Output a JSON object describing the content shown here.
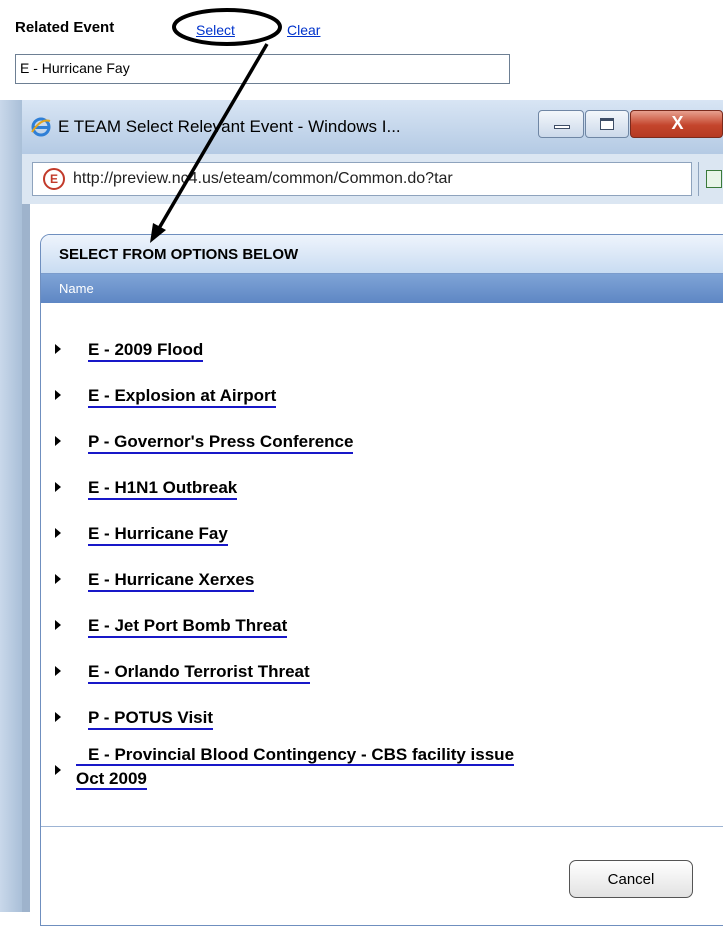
{
  "related_event": {
    "label": "Related Event",
    "select_link": "Select",
    "clear_link": "Clear",
    "value": "E - Hurricane Fay"
  },
  "window": {
    "title": "E TEAM Select Relevant Event - Windows I...",
    "close_glyph": "X",
    "address_icon_letter": "E",
    "url": "http://preview.nc4.us/eteam/common/Common.do?tar"
  },
  "dialog": {
    "header": "SELECT FROM OPTIONS BELOW",
    "column_header": "Name",
    "events": [
      "E - 2009 Flood",
      "E - Explosion at Airport",
      "P - Governor's Press Conference",
      "E - H1N1 Outbreak",
      "E - Hurricane Fay",
      "E - Hurricane Xerxes",
      "E - Jet Port Bomb Threat",
      "E - Orlando Terrorist Threat",
      "P - POTUS Visit"
    ],
    "multiline_event": {
      "line1": "E - Provincial Blood Contingency - CBS facility issue",
      "line2": "Oct 2009"
    },
    "cancel_label": "Cancel"
  },
  "colors": {
    "link_blue": "#0033cc",
    "column_header_blue": "#5e87c4",
    "close_red": "#c4452c"
  }
}
